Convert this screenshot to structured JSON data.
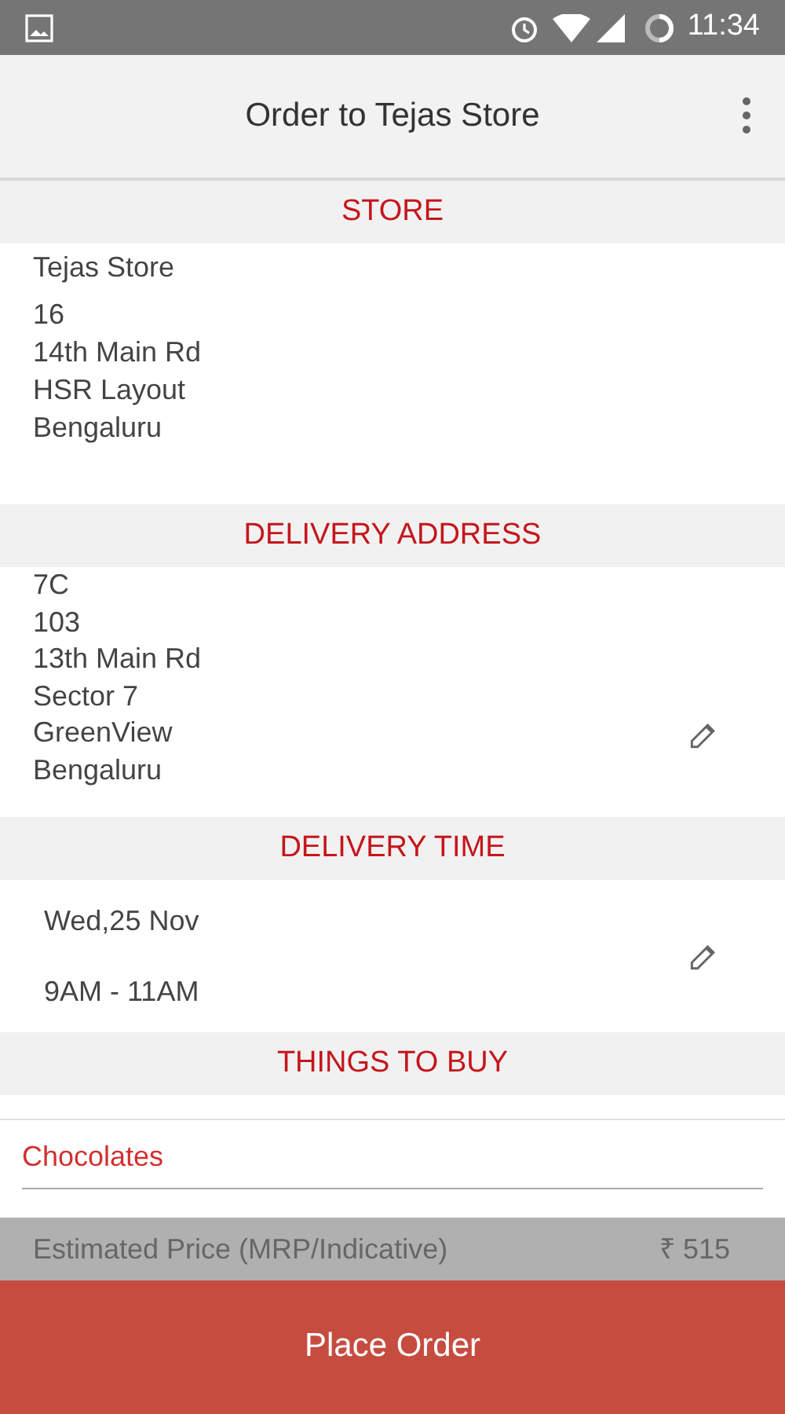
{
  "status_bar": {
    "time": "11:34"
  },
  "app_bar": {
    "title": "Order to Tejas Store"
  },
  "store": {
    "header": "STORE",
    "name": "Tejas Store",
    "lines": [
      "16",
      "14th Main Rd",
      "HSR Layout",
      "Bengaluru"
    ]
  },
  "delivery_address": {
    "header": "DELIVERY ADDRESS",
    "lines": [
      "7C",
      "103",
      "13th Main Rd",
      "Sector 7",
      "GreenView",
      "Bengaluru"
    ]
  },
  "delivery_time": {
    "header": "DELIVERY TIME",
    "date": "Wed,25 Nov",
    "slot": "9AM - 11AM"
  },
  "things_to_buy": {
    "header": "THINGS TO BUY",
    "categories": [
      "Chocolates"
    ]
  },
  "estimate": {
    "label": "Estimated Price (MRP/Indicative)",
    "amount": "₹ 515"
  },
  "place_order": {
    "label": "Place Order"
  }
}
